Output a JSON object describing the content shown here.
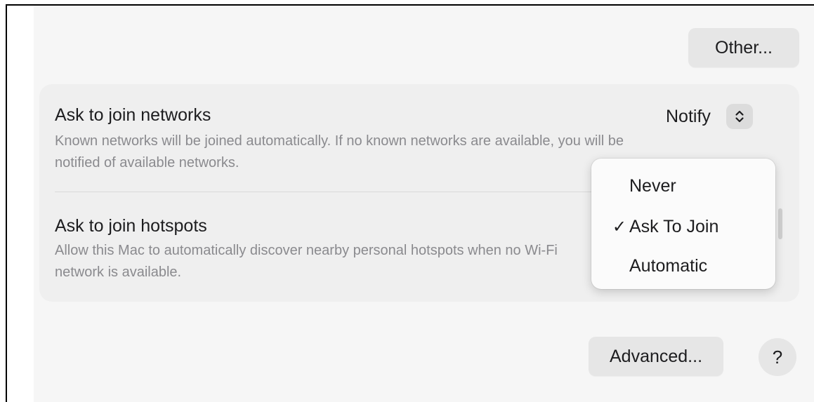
{
  "buttons": {
    "other": "Other...",
    "advanced": "Advanced...",
    "help": "?"
  },
  "settings": {
    "join_networks": {
      "title": "Ask to join networks",
      "description": "Known networks will be joined automatically. If no known networks are available, you will be notified of available networks.",
      "selected_value": "Notify"
    },
    "join_hotspots": {
      "title": "Ask to join hotspots",
      "description": "Allow this Mac to automatically discover nearby personal hotspots when no Wi-Fi network is available."
    }
  },
  "dropdown": {
    "check_mark": "✓",
    "options": [
      "Never",
      "Ask To Join",
      "Automatic"
    ],
    "selected": "Ask To Join"
  },
  "icons": {
    "stepper": "chevron-up-down-icon",
    "checkmark": "checkmark-icon"
  },
  "colors": {
    "background": "#f6f6f6",
    "card": "#efefef",
    "button": "#e6e6e6",
    "secondary_text": "#8a8a8e"
  }
}
